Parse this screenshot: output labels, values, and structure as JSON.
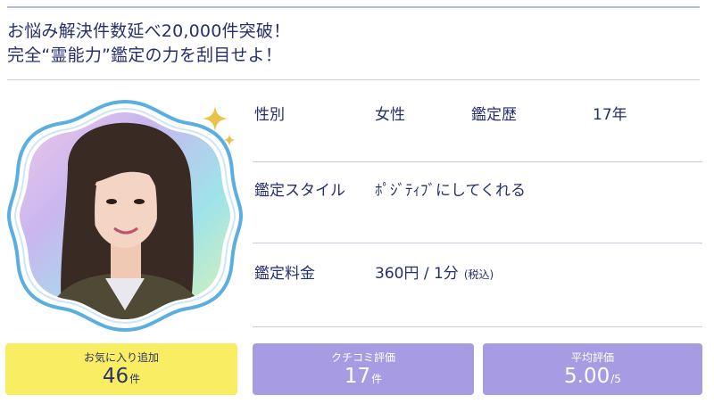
{
  "headline": {
    "line1": "お悩み解決件数延べ20,000件突破！",
    "line2": "完全“霊能力”鑑定の力を刮目せよ！"
  },
  "profile": {
    "gender_label": "性別",
    "gender_value": "女性",
    "experience_label": "鑑定歴",
    "experience_value": "17年",
    "style_label": "鑑定スタイル",
    "style_value": "ﾎﾟｼﾞﾃｨﾌﾞにしてくれる",
    "fee_label": "鑑定料金",
    "fee_value": "360円 / 1分",
    "fee_tax": "(税込)"
  },
  "stats": {
    "favorites": {
      "label": "お気に入り追加",
      "value": "46",
      "unit": "件"
    },
    "reviews": {
      "label": "クチコミ評価",
      "value": "17",
      "unit": "件"
    },
    "rating": {
      "label": "平均評価",
      "value": "5.00",
      "unit": "/5"
    }
  },
  "colors": {
    "frame_blue": "#5aaee0",
    "sparkle_gold": "#e8c34a",
    "favorites_yellow": "#f9ee63",
    "stat_purple": "#a79be3",
    "text_navy": "#262f6b"
  },
  "icons": {
    "sparkle": "sparkle-icon"
  }
}
